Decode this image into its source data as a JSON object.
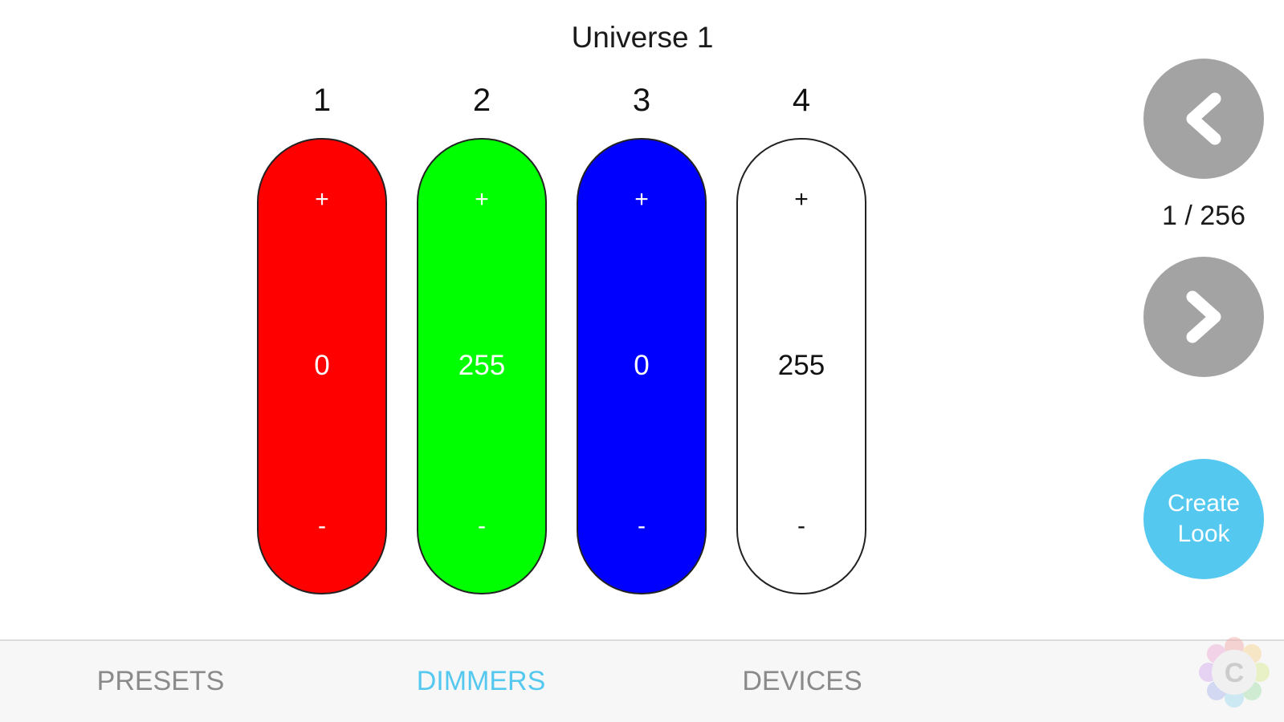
{
  "universe": {
    "title": "Universe 1"
  },
  "channels": [
    {
      "number": "1",
      "value": "0",
      "plus": "+",
      "minus": "-",
      "fill": "#ff0000",
      "text_color": "#ffffff"
    },
    {
      "number": "2",
      "value": "255",
      "plus": "+",
      "minus": "-",
      "fill": "#00ff00",
      "text_color": "#ffffff"
    },
    {
      "number": "3",
      "value": "0",
      "plus": "+",
      "minus": "-",
      "fill": "#0000ff",
      "text_color": "#ffffff"
    },
    {
      "number": "4",
      "value": "255",
      "plus": "+",
      "minus": "-",
      "fill": "#ffffff",
      "text_color": "#111111"
    }
  ],
  "pager": {
    "prev_icon": "chevron-left-icon",
    "next_icon": "chevron-right-icon",
    "indicator": "1 / 256",
    "button_color": "#a3a3a3"
  },
  "create_look": {
    "label": "Create\nLook",
    "color": "#55c8ef"
  },
  "tabs": [
    {
      "label": "PRESETS",
      "active": false
    },
    {
      "label": "DIMMERS",
      "active": true
    },
    {
      "label": "DEVICES",
      "active": false
    }
  ],
  "colors": {
    "tab_active": "#55c8ef",
    "tab_inactive": "#8a8a8a"
  },
  "watermark": {
    "letter": "C"
  }
}
